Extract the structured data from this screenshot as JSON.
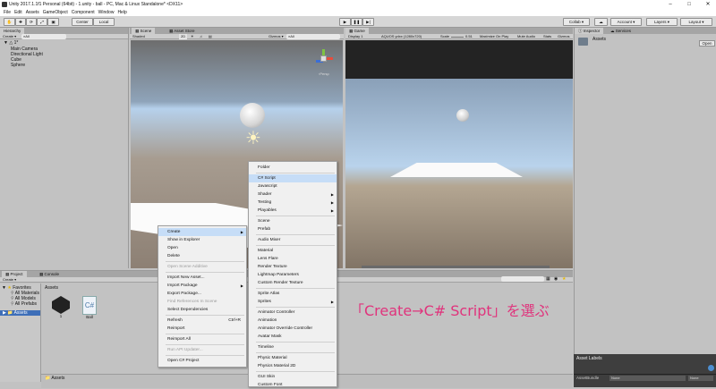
{
  "window": {
    "title": "Unity 2017.1.1f1 Personal (64bit) - 1.unity - ball - PC, Mac & Linux Standalone* <DX11>"
  },
  "menubar": [
    "File",
    "Edit",
    "Assets",
    "GameObject",
    "Component",
    "Window",
    "Help"
  ],
  "toolbar": {
    "pivot": "Center",
    "space": "Local",
    "collab": "Collab ▾",
    "account": "Account ▾",
    "layers": "Layers ▾",
    "layout": "Layout ▾"
  },
  "hierarchy": {
    "tab": "Hierarchy",
    "create": "Create ▾",
    "search": "⌕All",
    "scene": "1*",
    "items": [
      "Main Camera",
      "Directional Light",
      "Cube",
      "Sphere"
    ]
  },
  "scene": {
    "tab": "Scene",
    "tab2": "Asset Store",
    "shading": "Shaded",
    "mode": "2D",
    "gizmos": "Gizmos ▾",
    "search": "⌕All",
    "persp": "‹Persp"
  },
  "game": {
    "tab": "Game",
    "display": "Display 1",
    "resolution": "AQUOS ydxx (1280x720)",
    "scale": "Scale",
    "scale_val": "0.51",
    "maximize": "Maximize On Play",
    "mute": "Mute Audio",
    "stats": "Stats",
    "gizmos": "Gizmos"
  },
  "inspector": {
    "tab": "Inspector",
    "tab2": "Services",
    "title": "Assets",
    "open": "Open"
  },
  "project": {
    "tab": "Project",
    "tab2": "Console",
    "create": "Create ▾",
    "favorites": "Favorites",
    "fav_items": [
      "All Materials",
      "All Models",
      "All Prefabs"
    ],
    "assets_root": "Assets",
    "breadcrumb": "Assets",
    "files": [
      {
        "name": "1"
      },
      {
        "name": "Ball"
      }
    ],
    "footer": "Assets"
  },
  "asset_labels": {
    "title": "Asset Labels",
    "bundle_label": "AssetBundle",
    "bundle_val": "None",
    "variant_val": "None"
  },
  "context_menu": [
    {
      "label": "Create",
      "arrow": true,
      "hl": true
    },
    {
      "label": "Show in Explorer"
    },
    {
      "label": "Open"
    },
    {
      "label": "Delete"
    },
    {
      "sep": true
    },
    {
      "label": "Open Scene Additive",
      "dis": true
    },
    {
      "sep": true
    },
    {
      "label": "Import New Asset..."
    },
    {
      "label": "Import Package",
      "arrow": true
    },
    {
      "label": "Export Package..."
    },
    {
      "label": "Find References In Scene",
      "dis": true
    },
    {
      "label": "Select Dependencies"
    },
    {
      "sep": true
    },
    {
      "label": "Refresh",
      "shortcut": "Ctrl+R"
    },
    {
      "label": "Reimport"
    },
    {
      "sep": true
    },
    {
      "label": "Reimport All"
    },
    {
      "sep": true
    },
    {
      "label": "Run API Updater...",
      "dis": true
    },
    {
      "sep": true
    },
    {
      "label": "Open C# Project"
    }
  ],
  "submenu": [
    {
      "label": "Folder"
    },
    {
      "sep": true
    },
    {
      "label": "C# Script",
      "hl": true
    },
    {
      "label": "Javascript"
    },
    {
      "label": "Shader",
      "arrow": true
    },
    {
      "label": "Testing",
      "arrow": true
    },
    {
      "label": "Playables",
      "arrow": true
    },
    {
      "sep": true
    },
    {
      "label": "Scene"
    },
    {
      "label": "Prefab"
    },
    {
      "sep": true
    },
    {
      "label": "Audio Mixer"
    },
    {
      "sep": true
    },
    {
      "label": "Material"
    },
    {
      "label": "Lens Flare"
    },
    {
      "label": "Render Texture"
    },
    {
      "label": "Lightmap Parameters"
    },
    {
      "label": "Custom Render Texture"
    },
    {
      "sep": true
    },
    {
      "label": "Sprite Atlas"
    },
    {
      "label": "Sprites",
      "arrow": true
    },
    {
      "sep": true
    },
    {
      "label": "Animator Controller"
    },
    {
      "label": "Animation"
    },
    {
      "label": "Animator Override Controller"
    },
    {
      "label": "Avatar Mask"
    },
    {
      "sep": true
    },
    {
      "label": "Timeline"
    },
    {
      "sep": true
    },
    {
      "label": "Physic Material"
    },
    {
      "label": "Physics Material 2D"
    },
    {
      "sep": true
    },
    {
      "label": "GUI Skin"
    },
    {
      "label": "Custom Font"
    }
  ],
  "caption": "「Create→C# Script」を選ぶ"
}
